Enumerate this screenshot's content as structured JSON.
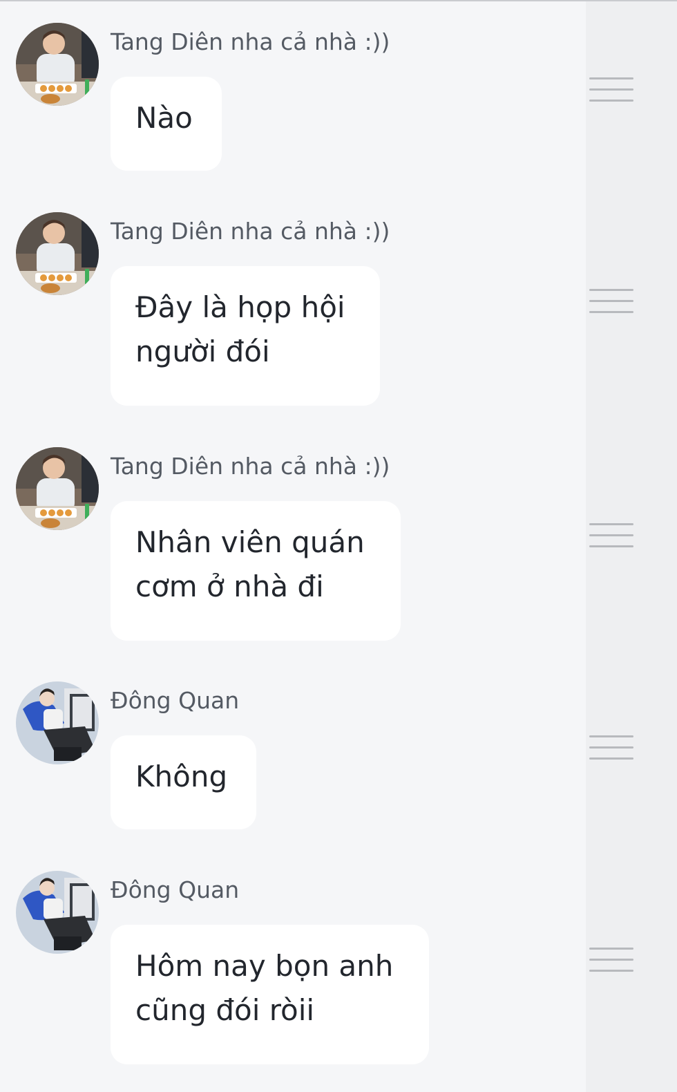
{
  "messages": [
    {
      "sender": "Tang Diên nha cả nhà :))",
      "text": "Nào",
      "avatar": "boy-eating-avatar"
    },
    {
      "sender": "Tang Diên nha cả nhà :))",
      "text": "Đây là họp hội người đói",
      "avatar": "boy-eating-avatar"
    },
    {
      "sender": "Tang Diên nha cả nhà :))",
      "text": "Nhân viên quán cơm ở nhà đi",
      "avatar": "boy-eating-avatar"
    },
    {
      "sender": "Đông Quan",
      "text": "Không",
      "avatar": "blue-jacket-avatar"
    },
    {
      "sender": "Đông Quan",
      "text": "Hôm nay bọn anh cũng đói ròii",
      "avatar": "blue-jacket-avatar"
    }
  ],
  "colors": {
    "background": "#f5f6f8",
    "bubble": "#ffffff",
    "sender_text": "#545a63",
    "message_text": "#22262d",
    "handle": "#b7b9bd"
  },
  "icons": {
    "drag_handle": "drag-handle-icon"
  }
}
